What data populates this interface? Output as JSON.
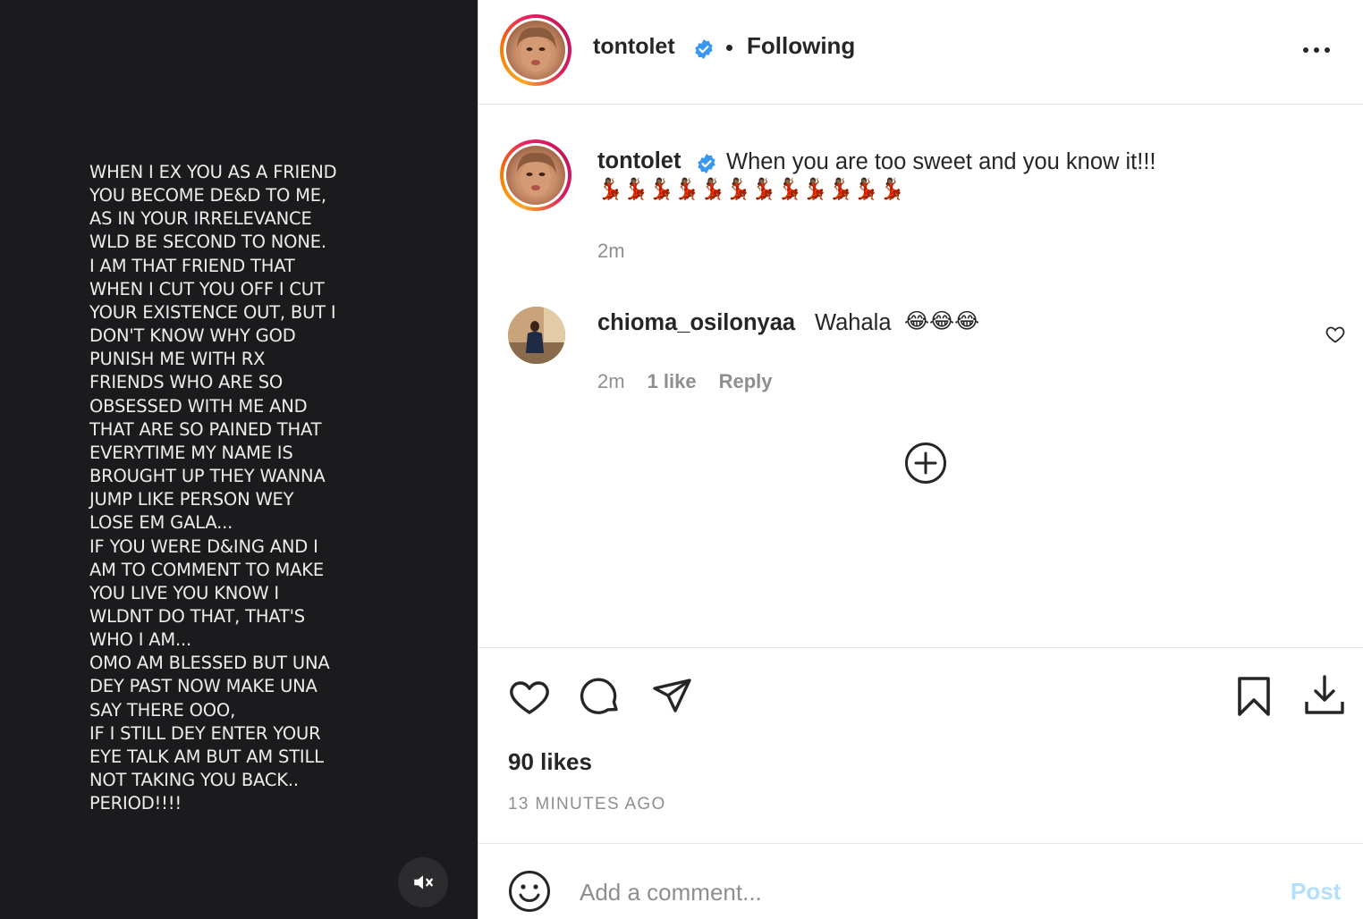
{
  "media": {
    "text": "WHEN I EX YOU AS A FRIEND\nYOU BECOME DE&D TO ME,\nAS IN YOUR IRRELEVANCE\nWLD BE SECOND TO NONE.\nI AM THAT FRIEND THAT\nWHEN I CUT YOU OFF I CUT\nYOUR EXISTENCE OUT, BUT I\nDON'T KNOW WHY GOD\nPUNISH ME WITH RX\nFRIENDS WHO ARE SO\nOBSESSED WITH ME AND\nTHAT ARE SO PAINED THAT\nEVERYTIME MY NAME IS\nBROUGHT UP THEY WANNA\nJUMP LIKE PERSON WEY\nLOSE EM GALA...\nIF YOU WERE D&ING AND I\nAM TO COMMENT TO MAKE\nYOU LIVE YOU KNOW I\nWLDNT DO THAT, THAT'S\nWHO I AM...\nOMO AM BLESSED BUT UNA\nDEY PAST NOW MAKE UNA\nSAY THERE OOO,\nIF I STILL DEY ENTER YOUR\nEYE TALK AM BUT AM STILL\nNOT TAKING YOU BACK..\nPERIOD!!!!",
    "mute_icon": "speaker-muted-icon"
  },
  "header": {
    "username": "tontolet",
    "separator": "•",
    "follow_status": "Following",
    "more_icon": "more-horizontal-icon"
  },
  "caption": {
    "username": "tontolet",
    "text": "When you are too sweet and you know it!!!",
    "emoji": "💃🏾💃🏾💃🏾💃🏾💃🏾💃🏾💃🏾💃🏾💃🏾💃🏾💃🏾💃🏾",
    "time": "2m"
  },
  "comments": [
    {
      "username": "chioma_osilonyaa",
      "text": "Wahala",
      "emoji": "😂😂😂",
      "time": "2m",
      "likes": "1 like",
      "reply": "Reply"
    }
  ],
  "stats": {
    "likes": "90 likes",
    "posted": "13 MINUTES AGO"
  },
  "comment_box": {
    "placeholder": "Add a comment...",
    "post_label": "Post"
  },
  "colors": {
    "media_bg": "#1b1a1d",
    "verified": "#3897f0",
    "muted_text": "#8e8e8e",
    "post_disabled": "#b2dffc"
  }
}
